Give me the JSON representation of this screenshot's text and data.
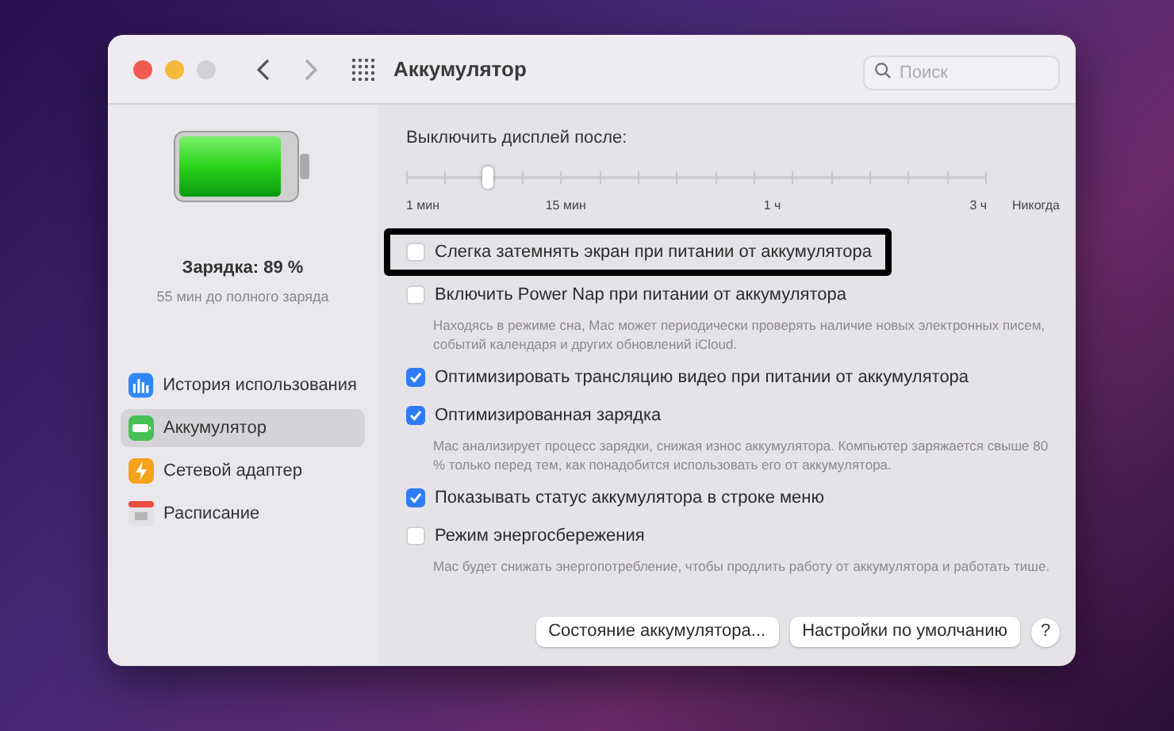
{
  "window": {
    "title": "Аккумулятор"
  },
  "search": {
    "placeholder": "Поиск"
  },
  "battery": {
    "level": 0.89,
    "charge": "Зарядка: 89 %",
    "remaining": "55 мин до полного заряда"
  },
  "sidebar": {
    "items": [
      {
        "label": "История использования",
        "kind": "history",
        "selected": false
      },
      {
        "label": "Аккумулятор",
        "kind": "battery",
        "selected": true
      },
      {
        "label": "Сетевой адаптер",
        "kind": "adapter",
        "selected": false
      },
      {
        "label": "Расписание",
        "kind": "schedule",
        "selected": false
      }
    ]
  },
  "display_off": {
    "label": "Выключить дисплей после:",
    "level": 0.14,
    "ticks": [
      "1 мин",
      "15 мин",
      "1 ч",
      "3 ч",
      "Никогда"
    ]
  },
  "options": [
    {
      "label": "Слегка затемнять экран при питании от аккумулятора",
      "checked": false,
      "highlighted": true
    },
    {
      "label": "Включить Power Nap при питании от аккумулятора",
      "checked": false,
      "highlighted": false,
      "description": "Находясь в режиме сна, Mac может периодически проверять наличие новых электронных писем, событий календаря и других обновлений iCloud."
    },
    {
      "label": "Оптимизировать трансляцию видео при питании от аккумулятора",
      "checked": true,
      "highlighted": false
    },
    {
      "label": "Оптимизированная зарядка",
      "checked": true,
      "highlighted": false,
      "description": "Mac анализирует процесс зарядки, снижая износ аккумулятора. Компьютер заряжается свыше 80 % только перед тем, как понадобится использовать его от аккумулятора."
    },
    {
      "label": "Показывать статус аккумулятора в строке меню",
      "checked": true,
      "highlighted": false
    },
    {
      "label": "Режим энергосбережения",
      "checked": false,
      "highlighted": false,
      "description": "Mac будет снижать энергопотребление, чтобы продлить работу от аккумулятора и работать тише."
    }
  ],
  "buttons": [
    "Состояние аккумулятора...",
    "Настройки по умолчанию"
  ],
  "help": "?"
}
